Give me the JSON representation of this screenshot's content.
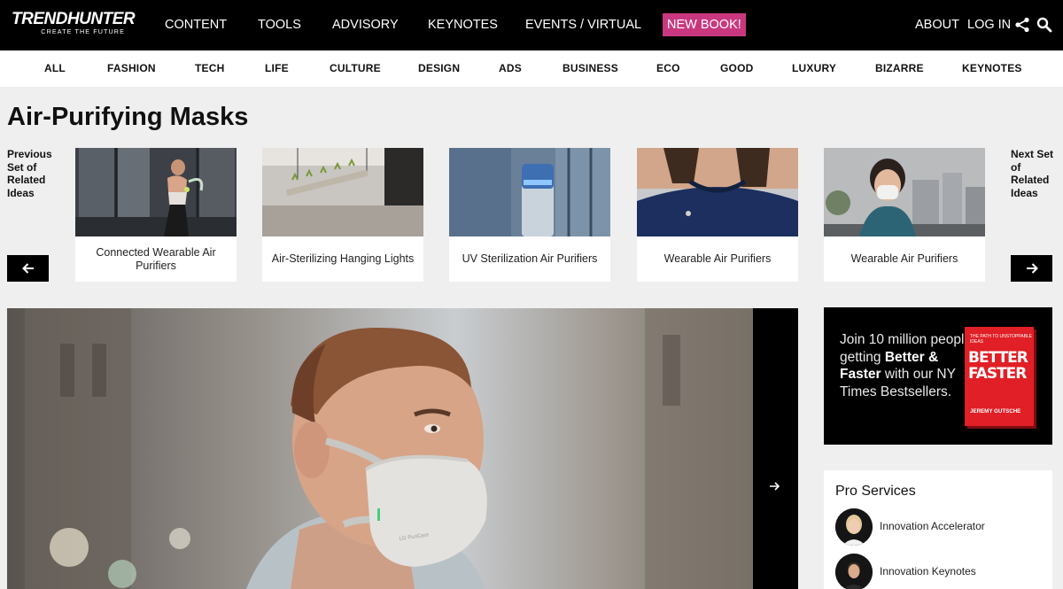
{
  "brand": {
    "name": "TRENDHUNTER",
    "tagline": "CREATE THE FUTURE"
  },
  "nav": {
    "items": [
      "CONTENT",
      "TOOLS",
      "ADVISORY",
      "KEYNOTES",
      "EVENTS / VIRTUAL"
    ],
    "new_book": "NEW BOOK!",
    "about": "ABOUT",
    "login": "LOG IN"
  },
  "categories": [
    "ALL",
    "FASHION",
    "TECH",
    "LIFE",
    "CULTURE",
    "DESIGN",
    "ADS",
    "BUSINESS",
    "ECO",
    "GOOD",
    "LUXURY",
    "BIZARRE",
    "KEYNOTES"
  ],
  "page": {
    "title": "Air-Purifying Masks"
  },
  "related": {
    "prev_label": "Previous Set of Related Ideas",
    "next_label": "Next Set of Related Ideas",
    "cards": [
      {
        "caption": "Connected Wearable Air Purifiers"
      },
      {
        "caption": "Air-Sterilizing Hanging Lights"
      },
      {
        "caption": "UV Sterilization Air Purifiers"
      },
      {
        "caption": "Wearable Air Purifiers"
      },
      {
        "caption": "Wearable Air Purifiers"
      }
    ]
  },
  "ad": {
    "line1": "Join 10 million people getting",
    "bold": "Better & Faster",
    "line2": "with our NY Times Bestsellers.",
    "book_small": "THE PATH TO UNSTOPPABLE IDEAS",
    "book_title_1": "BETTER",
    "book_title_2": "FASTER",
    "book_author": "JEREMY GUTSCHE"
  },
  "pro_services": {
    "title": "Pro Services",
    "items": [
      {
        "label": "Innovation Accelerator"
      },
      {
        "label": "Innovation Keynotes"
      }
    ]
  },
  "hero": {
    "product_text": "LG PuriCare"
  },
  "colors": {
    "accent": "#c9387f",
    "topbar": "#000000",
    "book": "#e01f26"
  }
}
